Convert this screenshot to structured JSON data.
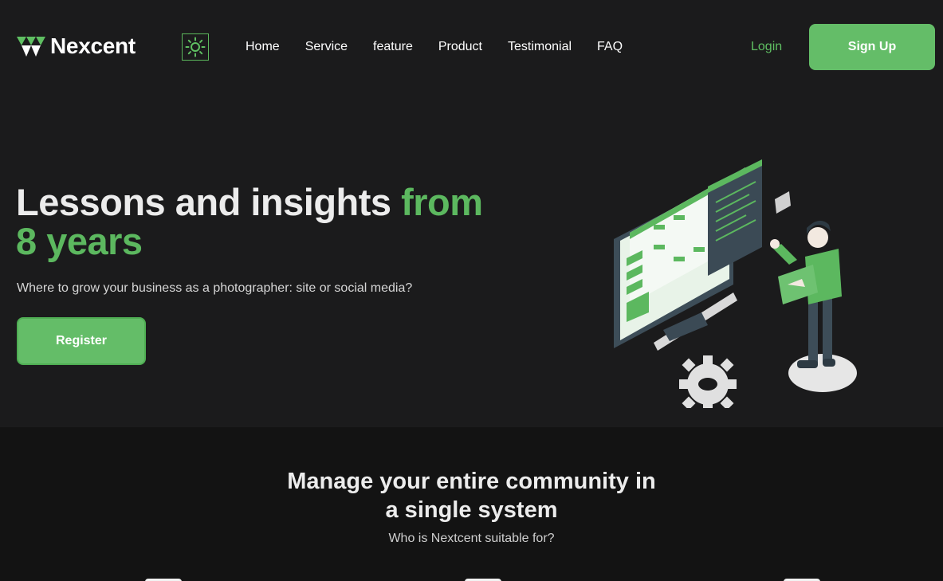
{
  "brand": {
    "name": "Nexcent",
    "accent": "#5cb85f"
  },
  "nav": {
    "items": [
      {
        "label": "Home"
      },
      {
        "label": "Service"
      },
      {
        "label": "feature"
      },
      {
        "label": "Product"
      },
      {
        "label": "Testimonial"
      },
      {
        "label": "FAQ"
      }
    ],
    "login_label": "Login",
    "signup_label": "Sign Up",
    "theme_toggle_icon": "sun-icon"
  },
  "hero": {
    "title_white": "Lessons and insights ",
    "title_green_1": "from",
    "title_green_2": "8 years",
    "subtitle": "Where to grow your business as a photographer: site or social media?",
    "register_label": "Register",
    "illustration_icon": "developer-illustration"
  },
  "community": {
    "title_line1": "Manage your entire community in",
    "title_line2": "a single system",
    "subtitle": "Who is Nextcent suitable for?"
  }
}
